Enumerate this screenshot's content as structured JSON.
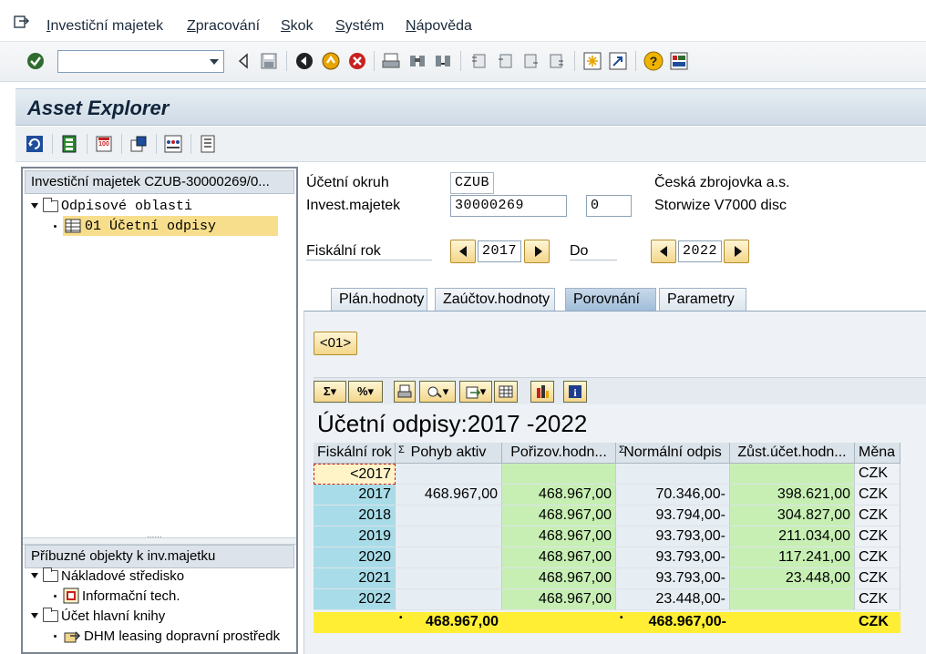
{
  "menubar": {
    "items": [
      "Investiční majetek",
      "Zpracování",
      "Skok",
      "Systém",
      "Nápověda"
    ]
  },
  "systoolbar": {
    "command_field_value": "",
    "icons": [
      "enter-icon",
      "back-icon",
      "save-icon",
      "back-nav-icon",
      "exit-icon",
      "cancel-icon",
      "print-icon",
      "find-icon",
      "find-next-icon",
      "first-page-icon",
      "prev-page-icon",
      "next-page-icon",
      "last-page-icon",
      "new-session-icon",
      "shortcut-icon",
      "help-icon",
      "layout-icon"
    ]
  },
  "title": "Asset Explorer",
  "left_panel": {
    "top_header": "Investiční majetek CZUB-30000269/0...",
    "tree_top": [
      {
        "label": "Odpisové oblasti",
        "type": "folder"
      },
      {
        "label": "01 Účetní odpisy",
        "type": "item",
        "selected": true
      }
    ],
    "bottom_header": "Příbuzné objekty k inv.majetku",
    "tree_bottom": [
      {
        "label": "Nákladové středisko",
        "type": "folder"
      },
      {
        "label": "Informační tech.",
        "type": "item"
      },
      {
        "label": "Účet hlavní knihy",
        "type": "folder"
      },
      {
        "label": "DHM leasing dopravní prostředk",
        "type": "item"
      }
    ]
  },
  "header_fields": {
    "company_code_label": "Účetní okruh",
    "company_code_value": "CZUB",
    "company_name": "Česká zbrojovka a.s.",
    "asset_label": "Invest.majetek",
    "asset_value": "30000269",
    "subnumber_value": "0",
    "asset_description": "Storwize V7000 disc",
    "fiscal_year_label": "Fiskální rok",
    "fiscal_year_value": "2017",
    "to_label": "Do",
    "to_value": "2022"
  },
  "tabs": [
    {
      "label": "Plán.hodnoty",
      "active": false
    },
    {
      "label": "Zaúčtov.hodnoty",
      "active": false
    },
    {
      "label": "Porovnání",
      "active": true
    },
    {
      "label": "Parametry",
      "active": false
    }
  ],
  "area_button": "<01>",
  "alv": {
    "title": "Účetní odpisy:2017 -2022",
    "columns": [
      "Fiskální rok",
      "Pohyb aktiv",
      "Pořizov.hodn...",
      "Normální odpis",
      "Zůst.účet.hodn...",
      "Měna"
    ],
    "sum_marks": [
      "",
      "Σ",
      "",
      "Σ",
      "",
      ""
    ],
    "rows": [
      [
        "<2017",
        "",
        "",
        "",
        "",
        "CZK"
      ],
      [
        "2017",
        "468.967,00",
        "468.967,00",
        "70.346,00-",
        "398.621,00",
        "CZK"
      ],
      [
        "2018",
        "",
        "468.967,00",
        "93.794,00-",
        "304.827,00",
        "CZK"
      ],
      [
        "2019",
        "",
        "468.967,00",
        "93.793,00-",
        "211.034,00",
        "CZK"
      ],
      [
        "2020",
        "",
        "468.967,00",
        "93.793,00-",
        "117.241,00",
        "CZK"
      ],
      [
        "2021",
        "",
        "468.967,00",
        "93.793,00-",
        "23.448,00",
        "CZK"
      ],
      [
        "2022",
        "",
        "468.967,00",
        "23.448,00-",
        "",
        "CZK"
      ]
    ],
    "totals": [
      "",
      "468.967,00",
      "",
      "468.967,00-",
      "",
      "CZK"
    ]
  },
  "colors": {
    "key_column": "#a8dce8",
    "green_column": "#c7efb4",
    "total_row": "#ffee33",
    "selected_tree": "#f7de8c"
  }
}
